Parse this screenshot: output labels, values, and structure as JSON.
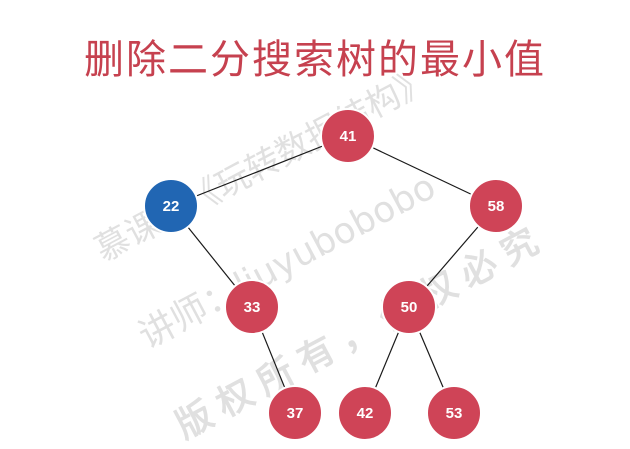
{
  "title": "删除二分搜索树的最小值",
  "colors": {
    "title": "#c6414f",
    "node_default": "#cf4457",
    "node_highlight": "#2166b3",
    "node_stroke": "#ffffff",
    "edge": "#1a1a1a",
    "label": "#ffffff"
  },
  "watermark": {
    "line1": "慕课网《玩转数据结构》",
    "line2": "讲师：liuyubobobo",
    "line3": "版权所有，侵权必究"
  },
  "tree": {
    "nodes": [
      {
        "id": "n41",
        "label": "41",
        "highlight": false
      },
      {
        "id": "n22",
        "label": "22",
        "highlight": true
      },
      {
        "id": "n58",
        "label": "58",
        "highlight": false
      },
      {
        "id": "n33",
        "label": "33",
        "highlight": false
      },
      {
        "id": "n50",
        "label": "50",
        "highlight": false
      },
      {
        "id": "n37",
        "label": "37",
        "highlight": false
      },
      {
        "id": "n42",
        "label": "42",
        "highlight": false
      },
      {
        "id": "n53",
        "label": "53",
        "highlight": false
      }
    ],
    "edges": [
      [
        "n41",
        "n22"
      ],
      [
        "n41",
        "n58"
      ],
      [
        "n22",
        "n33"
      ],
      [
        "n58",
        "n50"
      ],
      [
        "n33",
        "n37"
      ],
      [
        "n50",
        "n42"
      ],
      [
        "n50",
        "n53"
      ]
    ]
  }
}
